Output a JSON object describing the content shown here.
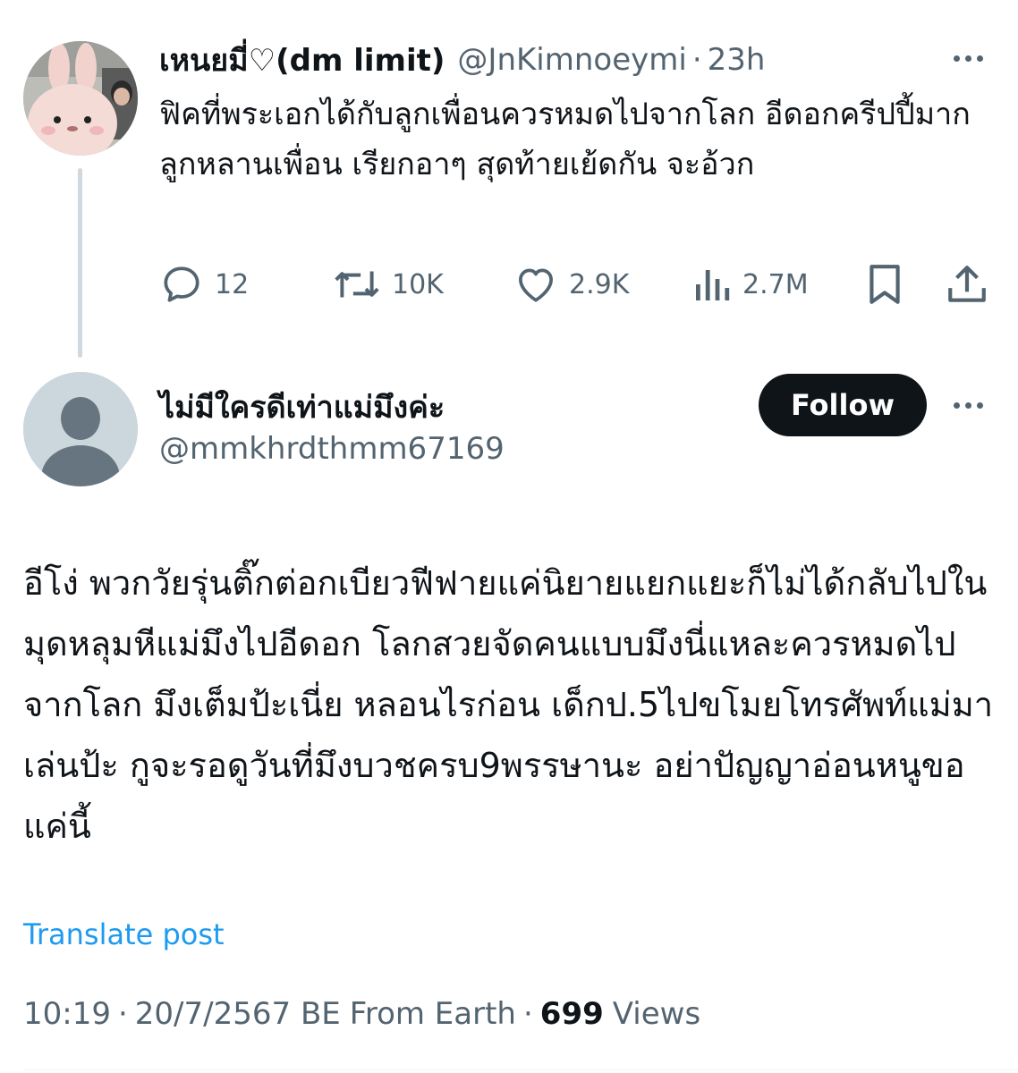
{
  "parent_tweet": {
    "author_name": "เหนยมี่♡(dm limit)",
    "author_handle": "@JnKimnoeymi",
    "separator": "·",
    "time_ago": "23h",
    "text": "ฟิคที่พระเอกได้กับลูกเพื่อนควรหมดไปจากโลก อีดอกครีปปี้มาก ลูกหลานเพื่อน เรียกอาๆ สุดท้ายเย้ดกัน จะอ้วก",
    "actions": {
      "replies": "12",
      "reposts": "10K",
      "likes": "2.9K",
      "views": "2.7M"
    }
  },
  "main_tweet": {
    "author_name": "ไม่มีใครดีเท่าแม่มึงค่ะ",
    "author_handle": "@mmkhrdthmm67169",
    "follow_label": "Follow",
    "text": "อีโง่ พวกวัยรุ่นติ๊กต่อกเบียวฟีฟายแค่นิยายแยกแยะก็ไม่ได้กลับไปในมุดหลุมหีแม่มึงไปอีดอก โลกสวยจัดคนแบบมึงนี่แหละควรหมดไปจากโลก มึงเต็มป้ะเนี่ย หลอนไรก่อน เด็กป.5ไปขโมยโทรศัพท์แม่มาเล่นป้ะ กูจะรอดูวันที่มึงบวชครบ9พรรษานะ อย่าปัญญาอ่อนหนูขอแค่นี้",
    "translate_label": "Translate post",
    "time": "10:19",
    "date": "20/7/2567 BE",
    "source": "From Earth",
    "separator": "·",
    "views_count": "699",
    "views_label": "Views"
  },
  "colors": {
    "text_primary": "#0f1419",
    "text_secondary": "#536471",
    "link": "#1d9bf0",
    "follow_bg": "#0f1419",
    "thread_line": "#cfd9de"
  },
  "icons": [
    "more-icon",
    "reply-icon",
    "repost-icon",
    "like-icon",
    "views-icon",
    "bookmark-icon",
    "share-icon",
    "default-avatar-icon"
  ]
}
